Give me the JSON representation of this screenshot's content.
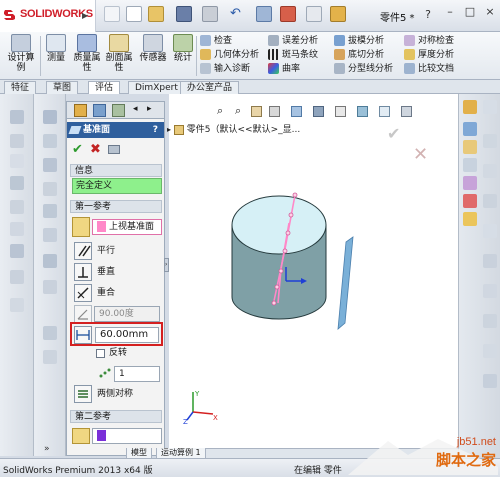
{
  "app": {
    "brand": "SOLIDWORKS",
    "document_title": "零件5 *",
    "help": "?",
    "window_buttons": [
      "–",
      "□",
      "×"
    ]
  },
  "command_manager": {
    "big_tools": [
      "设计算例",
      "测量",
      "质量属性",
      "剖面属性",
      "传感器",
      "统计"
    ],
    "small_tools": [
      [
        "检查",
        "几何体分析",
        "输入诊断"
      ],
      [
        "误差分析",
        "斑马条纹",
        "曲率"
      ],
      [
        "拔模分析",
        "底切分析",
        "分型线分析"
      ],
      [
        "对称检查",
        "厚度分析",
        "比较文档"
      ]
    ]
  },
  "tabs": [
    "特征",
    "草图",
    "评估",
    "DimXpert",
    "办公室产品"
  ],
  "active_tab": "评估",
  "property_manager": {
    "title": "基准面",
    "help": "?",
    "info_header": "信息",
    "info_status": "完全定义",
    "first_ref_header": "第一参考",
    "first_ref_value": "上视基准面",
    "options": [
      "平行",
      "垂直",
      "重合"
    ],
    "angle_value": "90.00度",
    "distance_value": "60.00mm",
    "reverse_label": "反转",
    "count_value": "1",
    "symmetric_label": "两侧对称",
    "second_ref_header": "第二参考"
  },
  "feature_tree": {
    "root_label": "零件5（默认<<默认>_显..."
  },
  "model_tabs": [
    "模型",
    "运动算例 1"
  ],
  "status": {
    "left": "SolidWorks Premium 2013 x64 版",
    "right": "在编辑 零件"
  },
  "watermark": {
    "url": "jb51.net",
    "name": "脚本之家"
  },
  "colors": {
    "accent_red": "#d01f2a",
    "status_green": "#8ef08c",
    "highlight_box": "#d42020",
    "cylinder_side": "#7fa0a6",
    "cylinder_top": "#d6f0f6",
    "plane_blue": "#7ab0d8",
    "sketch_pink": "#ff88c8"
  }
}
